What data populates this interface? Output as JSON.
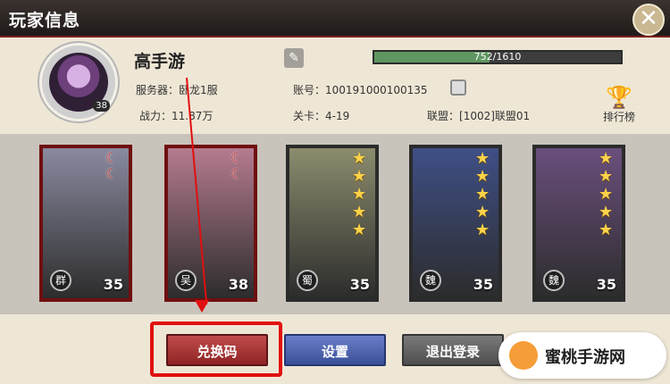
{
  "window": {
    "title": "玩家信息",
    "close_icon": "close-icon"
  },
  "player": {
    "name": "高手游",
    "avatar_level": "38",
    "exp_text": "752/1610",
    "exp_current": 752,
    "exp_max": 1610,
    "server_label": "服务器：",
    "server_value": "卧龙1服",
    "account_label": "账号：",
    "account_value": "100191000100135",
    "power_label": "战力：",
    "power_value": "11.87万",
    "stage_label": "关卡：",
    "stage_value": "4-19",
    "alliance_label": "联盟：",
    "alliance_value": "[1002]联盟01"
  },
  "ranking": {
    "label": "排行榜",
    "icon": "trophy-icon"
  },
  "heroes": [
    {
      "faction": "群",
      "level": "35",
      "stars": 0,
      "moons": 2,
      "color": "#8a8aa0"
    },
    {
      "faction": "吴",
      "level": "38",
      "stars": 0,
      "moons": 2,
      "color": "#b57b8f"
    },
    {
      "faction": "蜀",
      "level": "35",
      "stars": 5,
      "moons": 0,
      "color": "#8c8c6e"
    },
    {
      "faction": "魏",
      "level": "35",
      "stars": 5,
      "moons": 0,
      "color": "#3f4f86"
    },
    {
      "faction": "魏",
      "level": "35",
      "stars": 5,
      "moons": 0,
      "color": "#6a4f7d"
    }
  ],
  "buttons": {
    "redeem": "兑换码",
    "settings": "设置",
    "logout": "退出登录"
  },
  "watermark": "蜜桃手游网",
  "colors": {
    "accent_red": "#e10f0f",
    "title_bg": "#1f1a18"
  }
}
